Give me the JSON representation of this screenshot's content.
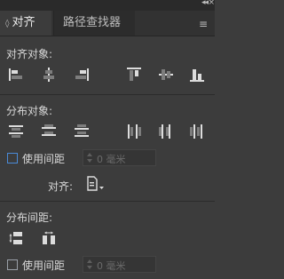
{
  "window": {
    "collapse_glyph": "◂◂",
    "close_glyph": "×"
  },
  "tabs": [
    {
      "label": "对齐",
      "arrow": "◊"
    },
    {
      "label": "路径查找器"
    }
  ],
  "menu_glyph": "≡",
  "align_objects": {
    "title": "对齐对象:",
    "icons": [
      "align-left-icon",
      "align-horizontal-center-icon",
      "align-right-icon",
      "align-top-icon",
      "align-vertical-center-icon",
      "align-bottom-icon"
    ]
  },
  "distribute_objects": {
    "title": "分布对象:",
    "icons": [
      "distribute-top-icon",
      "distribute-vertical-center-icon",
      "distribute-bottom-icon",
      "distribute-left-icon",
      "distribute-horizontal-center-icon",
      "distribute-right-icon"
    ],
    "use_spacing_label": "使用间距",
    "spacing_value": "0 毫米"
  },
  "align_to": {
    "label": "对齐:",
    "icon": "align-to-selection-icon"
  },
  "distribute_spacing": {
    "title": "分布间距:",
    "icons": [
      "vertical-distribute-space-icon",
      "horizontal-distribute-space-icon"
    ],
    "use_spacing_label": "使用间距",
    "spacing_value": "0 毫米"
  },
  "colors": {
    "icon_light": "#dcdcdc",
    "icon_dark": "#7d7d7d",
    "checkbox_blue": "#4a8ad6"
  }
}
